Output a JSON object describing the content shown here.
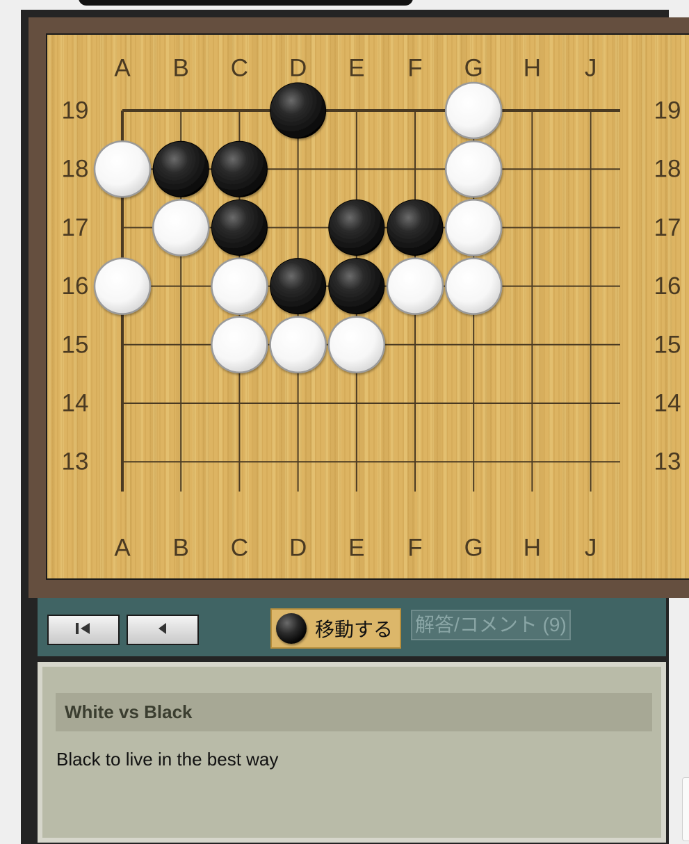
{
  "board": {
    "columns": [
      "A",
      "B",
      "C",
      "D",
      "E",
      "F",
      "G",
      "H",
      "J"
    ],
    "rows": [
      "19",
      "18",
      "17",
      "16",
      "15",
      "14",
      "13"
    ],
    "stones": [
      {
        "color": "black",
        "point": "D19"
      },
      {
        "color": "white",
        "point": "G19"
      },
      {
        "color": "white",
        "point": "A18"
      },
      {
        "color": "black",
        "point": "B18"
      },
      {
        "color": "black",
        "point": "C18"
      },
      {
        "color": "white",
        "point": "G18"
      },
      {
        "color": "white",
        "point": "B17"
      },
      {
        "color": "black",
        "point": "C17"
      },
      {
        "color": "black",
        "point": "E17"
      },
      {
        "color": "black",
        "point": "F17"
      },
      {
        "color": "white",
        "point": "G17"
      },
      {
        "color": "white",
        "point": "A16"
      },
      {
        "color": "white",
        "point": "C16"
      },
      {
        "color": "black",
        "point": "D16"
      },
      {
        "color": "black",
        "point": "E16"
      },
      {
        "color": "white",
        "point": "F16"
      },
      {
        "color": "white",
        "point": "G16"
      },
      {
        "color": "white",
        "point": "C15"
      },
      {
        "color": "white",
        "point": "D15"
      },
      {
        "color": "white",
        "point": "E15"
      }
    ]
  },
  "controls": {
    "move_label": "移動する",
    "comment_label": "解答/コメント (9)",
    "first_icon": "skip-to-start-icon",
    "prev_icon": "step-back-icon",
    "move_icon": "black-stone-icon"
  },
  "info": {
    "title": "White vs Black",
    "description": "Black to live in the best way"
  },
  "colors": {
    "board": "#ddb462",
    "frame": "#654f3f",
    "controls_bg": "#406464",
    "panel_bg": "#b9bba8"
  }
}
